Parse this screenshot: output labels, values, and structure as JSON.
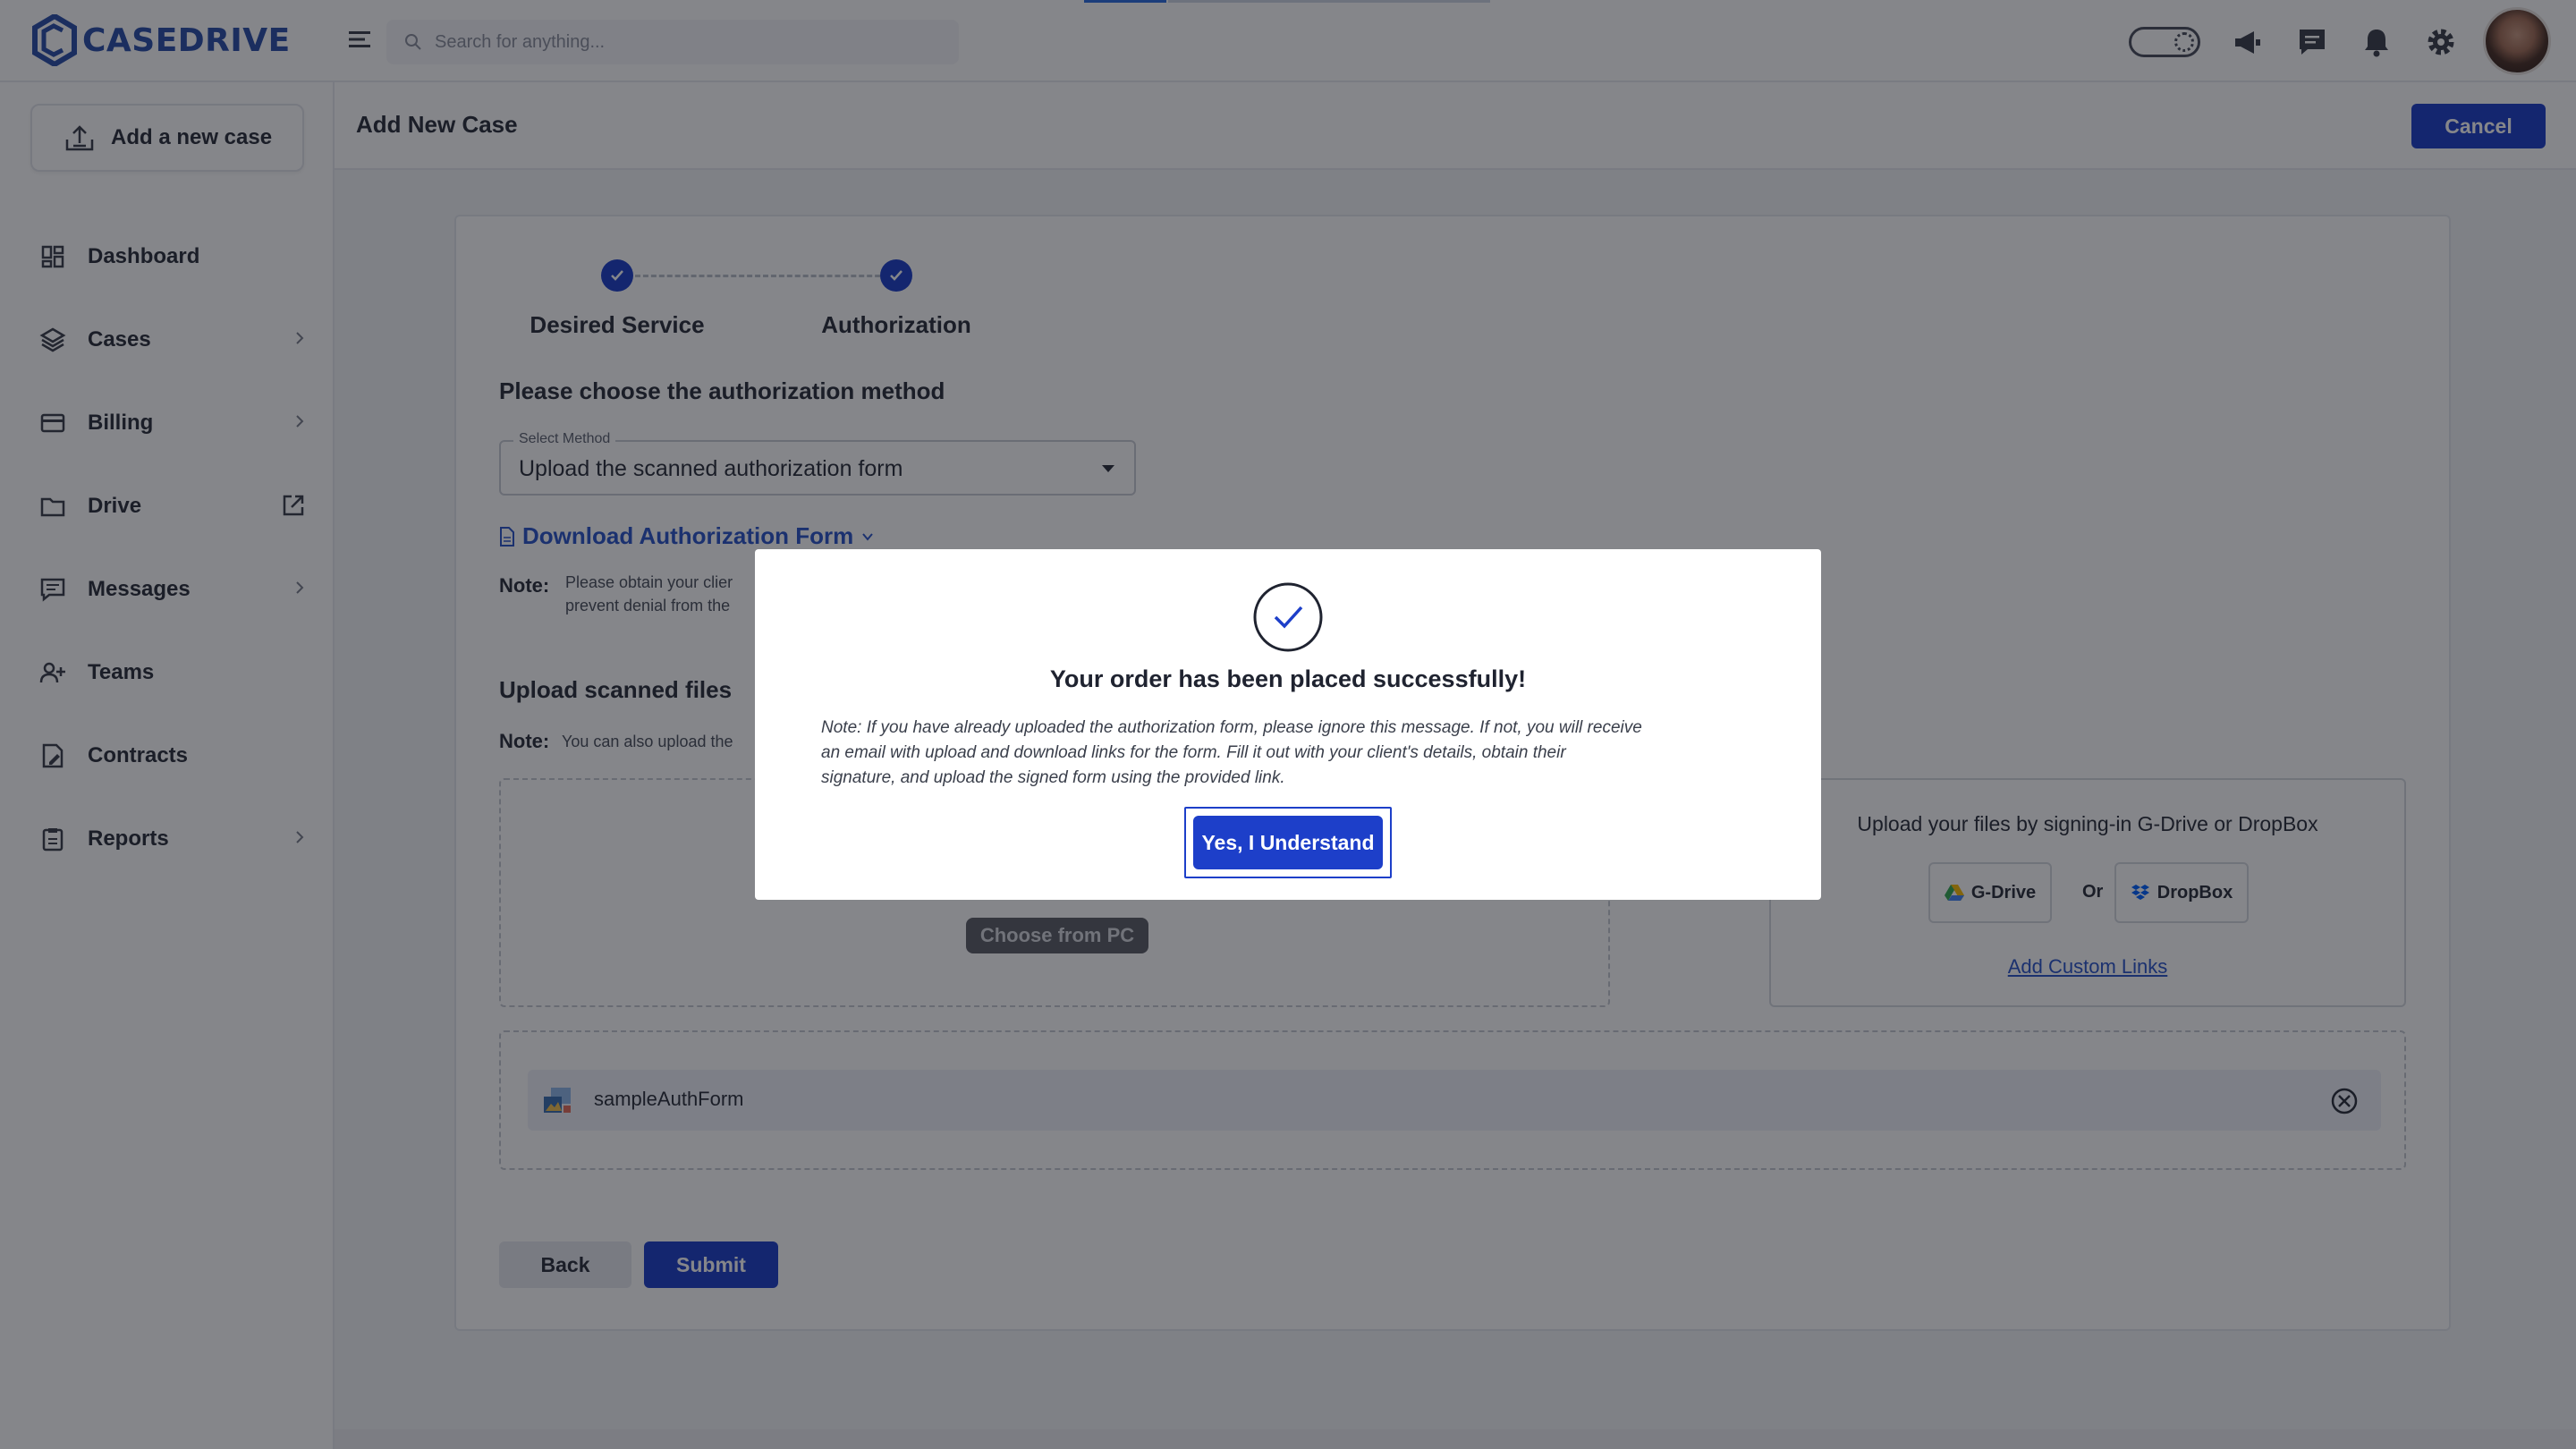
{
  "brand": {
    "name": "CASEDRIVE"
  },
  "search": {
    "placeholder": "Search for anything..."
  },
  "sidebar": {
    "add_case_label": "Add a new case",
    "items": [
      {
        "label": "Dashboard",
        "icon": "dashboard-icon",
        "has_chevron": false
      },
      {
        "label": "Cases",
        "icon": "layers-icon",
        "has_chevron": true
      },
      {
        "label": "Billing",
        "icon": "card-icon",
        "has_chevron": true
      },
      {
        "label": "Drive",
        "icon": "folder-icon",
        "has_external": true
      },
      {
        "label": "Messages",
        "icon": "message-icon",
        "has_chevron": true
      },
      {
        "label": "Teams",
        "icon": "users-icon",
        "has_chevron": false
      },
      {
        "label": "Contracts",
        "icon": "contract-icon",
        "has_chevron": false
      },
      {
        "label": "Reports",
        "icon": "report-icon",
        "has_chevron": true
      }
    ]
  },
  "header": {
    "title": "Add New Case",
    "cancel_label": "Cancel"
  },
  "stepper": {
    "steps": [
      {
        "label": "Desired Service",
        "completed": true
      },
      {
        "label": "Authorization",
        "completed": true
      }
    ]
  },
  "auth": {
    "heading": "Please choose the authorization method",
    "select_legend": "Select Method",
    "select_value": "Upload the scanned authorization form",
    "download_link": "Download Authorization Form",
    "note_label": "Note:",
    "note_line1": "Please obtain your clier",
    "note_line2": "prevent denial from the"
  },
  "upload": {
    "heading": "Upload scanned files",
    "note_label": "Note:",
    "note_text": "You can also upload the",
    "choose_label": "Choose from PC",
    "cloud_title": "Upload your files by signing-in G-Drive or DropBox",
    "gdrive_label": "G-Drive",
    "or_label": "Or",
    "dropbox_label": "DropBox",
    "custom_links_label": "Add Custom Links",
    "files": [
      {
        "name": "sampleAuthForm"
      }
    ]
  },
  "footer_buttons": {
    "back_label": "Back",
    "submit_label": "Submit"
  },
  "modal": {
    "title": "Your order has been placed successfully!",
    "note_line1": "Note: If you have already uploaded the authorization form, please ignore this message. If not, you will receive",
    "note_line2": "an email with upload and download links for the form. Fill it out with your client's details, obtain their",
    "note_line3": "signature, and upload the signed form using the provided link.",
    "confirm_label": "Yes, I Understand"
  },
  "colors": {
    "primary": "#1d3fc9",
    "brand": "#2b4fa8",
    "link": "#2b55c9",
    "overlay": "rgba(12,14,22,0.5)"
  }
}
